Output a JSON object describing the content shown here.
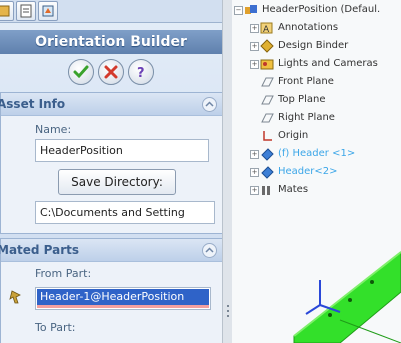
{
  "panel": {
    "title": "Orientation Builder",
    "tabs": [
      "feature-manager-tab",
      "property-manager-tab",
      "configuration-manager-tab"
    ],
    "actions": [
      {
        "name": "ok-button",
        "icon": "checkmark-icon",
        "color": "#3aa22b"
      },
      {
        "name": "cancel-button",
        "icon": "x-icon",
        "color": "#d33a2c"
      },
      {
        "name": "help-button",
        "icon": "question-icon",
        "color": "#6a3fb5"
      }
    ]
  },
  "asset_info": {
    "header": "Asset Info",
    "name_label": "Name:",
    "name_value": "HeaderPosition",
    "save_button": "Save Directory:",
    "directory_value": "C:\\Documents and Setting"
  },
  "mated_parts": {
    "header": "Mated Parts",
    "from_label": "From Part:",
    "from_value": "Header-1@HeaderPosition",
    "to_label": "To Part:"
  },
  "tree": {
    "root": "HeaderPosition  (Defaul.",
    "items": [
      {
        "label": "Annotations",
        "icon": "annotations-icon",
        "expandable": true
      },
      {
        "label": "Design Binder",
        "icon": "design-binder-icon",
        "expandable": true
      },
      {
        "label": "Lights and Cameras",
        "icon": "lights-cameras-icon",
        "expandable": true
      },
      {
        "label": "Front Plane",
        "icon": "plane-icon",
        "expandable": false
      },
      {
        "label": "Top Plane",
        "icon": "plane-icon",
        "expandable": false
      },
      {
        "label": "Right Plane",
        "icon": "plane-icon",
        "expandable": false
      },
      {
        "label": "Origin",
        "icon": "origin-icon",
        "expandable": false
      },
      {
        "label": "(f) Header <1>",
        "icon": "part-icon",
        "expandable": true,
        "highlight": true
      },
      {
        "label": "Header<2>",
        "icon": "part-icon",
        "expandable": true,
        "highlight": true
      },
      {
        "label": "Mates",
        "icon": "mates-icon",
        "expandable": true
      }
    ]
  },
  "colors": {
    "accent_blue": "#3ba6e8",
    "part_green": "#33e02a",
    "selection": "#2f63c8"
  }
}
